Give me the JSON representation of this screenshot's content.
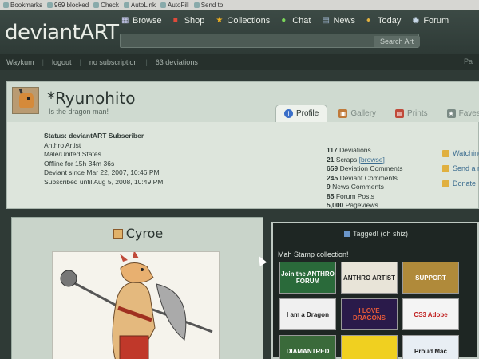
{
  "browser": {
    "items": [
      "Bookmarks",
      "969 blocked",
      "Check",
      "AutoLink",
      "AutoFill",
      "Send to"
    ]
  },
  "site": {
    "logo": "deviantART",
    "nav": [
      {
        "label": "Browse",
        "icon": "grid-icon",
        "color": "#d6d6ff"
      },
      {
        "label": "Shop",
        "icon": "shop-icon",
        "color": "#e04a3a"
      },
      {
        "label": "Collections",
        "icon": "star-icon",
        "color": "#f0b020"
      },
      {
        "label": "Chat",
        "icon": "chat-icon",
        "color": "#7bd65a"
      },
      {
        "label": "News",
        "icon": "news-icon",
        "color": "#9ab0c8"
      },
      {
        "label": "Today",
        "icon": "today-icon",
        "color": "#e0b040"
      },
      {
        "label": "Forum",
        "icon": "forum-icon",
        "color": "#c8d8e8"
      }
    ],
    "search_placeholder": "Search Art"
  },
  "userbar": {
    "name": "Waykum",
    "logout": "logout",
    "subscription": "no subscription",
    "deviations": "63 deviations",
    "right": "Pa"
  },
  "profile": {
    "username": "*Ryunohito",
    "tagline": "Is the dragon man!",
    "tabs": [
      {
        "label": "Profile",
        "active": true,
        "icon_color": "#3a6fc8"
      },
      {
        "label": "Gallery",
        "active": false,
        "icon_color": "#c07a3a"
      },
      {
        "label": "Prints",
        "active": false,
        "icon_color": "#c04a3a"
      },
      {
        "label": "Faves",
        "active": false,
        "icon_color": "#7a8a84"
      }
    ],
    "info": {
      "status": "Status: deviantART Subscriber",
      "line1": "Anthro Artist",
      "line2": "Male/United States",
      "line3": "Offline for 15h 34m 36s",
      "line4": "Deviant since Mar 22, 2007, 10:46 PM",
      "line5": "Subscribed until Aug 5, 2008, 10:49 PM"
    },
    "stats": [
      {
        "num": "117",
        "label": "Deviations"
      },
      {
        "num": "21",
        "label": "Scraps",
        "link": "[browse]"
      },
      {
        "num": "659",
        "label": "Deviation Comments"
      },
      {
        "num": "245",
        "label": "Deviant Comments"
      },
      {
        "num": "9",
        "label": "News Comments"
      },
      {
        "num": "85",
        "label": "Forum Posts"
      },
      {
        "num": "5,000",
        "label": "Pageviews"
      }
    ],
    "side_links": [
      "Watching",
      "Send a n",
      "Donate"
    ]
  },
  "deviation": {
    "title": "Cyroe"
  },
  "stamps": {
    "title": "Tagged! (oh shiz)",
    "heading": "Mah Stamp collection!",
    "items": [
      {
        "text": "Join the ANTHRO FORUM",
        "bg": "#2a6a3a"
      },
      {
        "text": "ANTHRO ARTIST",
        "bg": "#e8e4d8"
      },
      {
        "text": "SUPPORT",
        "bg": "#b08a3a"
      },
      {
        "text": "I am a Dragon",
        "bg": "#f0f0f0"
      },
      {
        "text": "I LOVE DRAGONS",
        "bg": "#2a1a4a"
      },
      {
        "text": "CS3 Adobe",
        "bg": "#f4f4f4"
      },
      {
        "text": "DIAMANTRED",
        "bg": "#3a6a3a"
      },
      {
        "text": "",
        "bg": "#f0d020"
      },
      {
        "text": "Proud Mac",
        "bg": "#e8eef4"
      }
    ]
  }
}
